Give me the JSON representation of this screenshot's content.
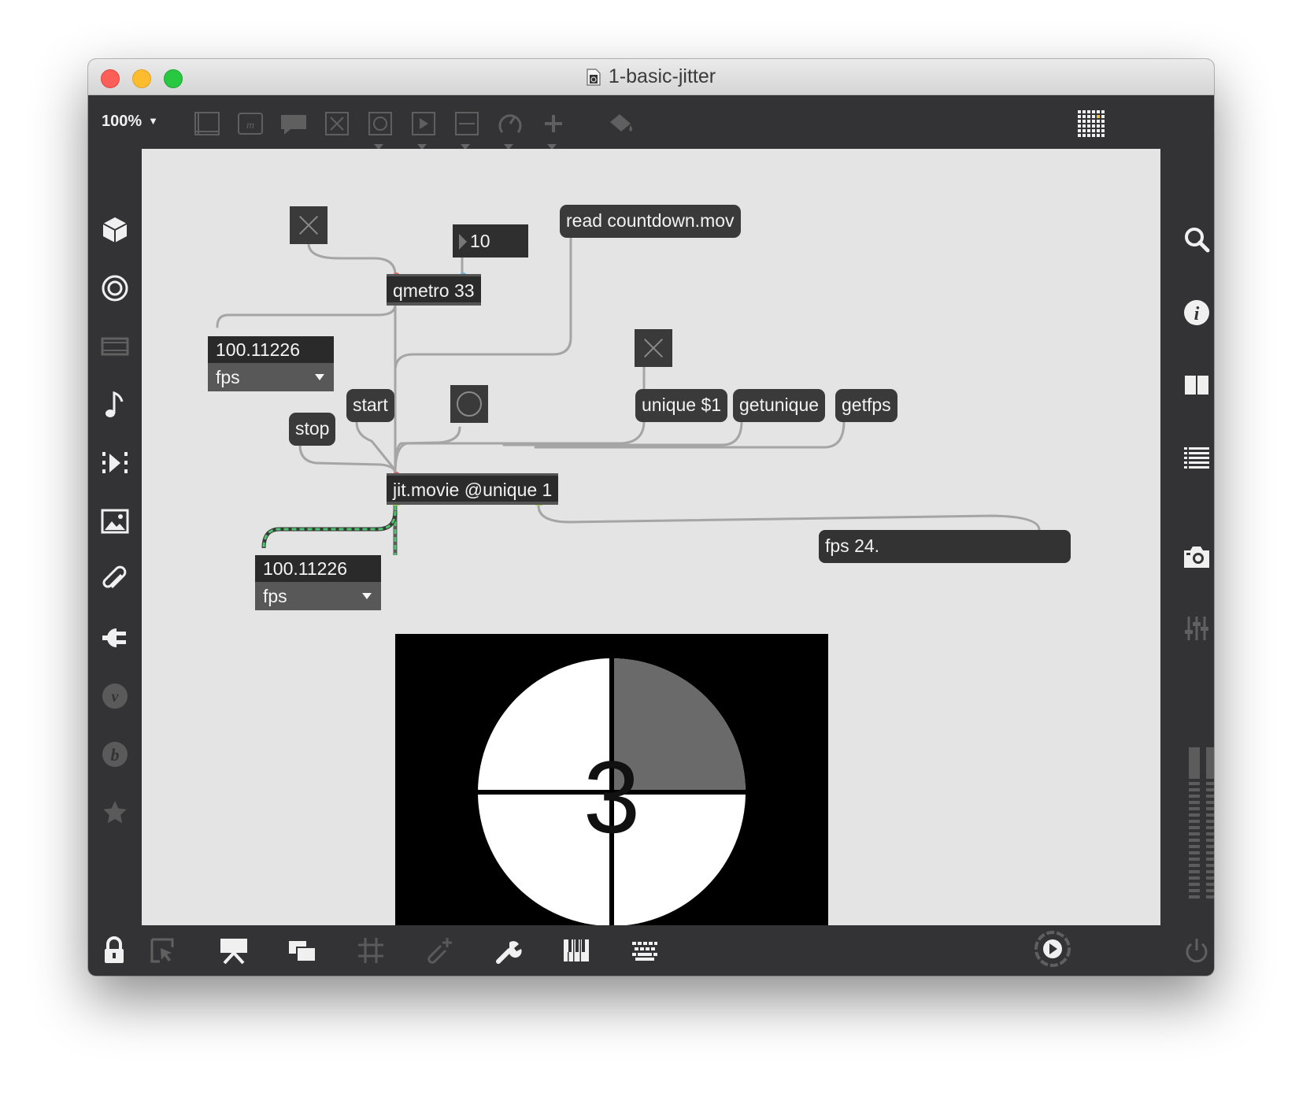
{
  "window": {
    "title": "1-basic-jitter"
  },
  "toolbar": {
    "zoom": "100%",
    "icons": [
      "new-object-icon",
      "message-box-icon",
      "comment-icon",
      "toggle-icon",
      "button-icon",
      "play-icon",
      "slider-icon",
      "dial-icon",
      "plus-icon",
      "paint-bucket-icon"
    ],
    "grid_icon": "grid-icon"
  },
  "left_sidebar": [
    "cube-icon",
    "target-icon",
    "film-icon",
    "music-note-icon",
    "step-icon",
    "image-icon",
    "paperclip-icon",
    "plug-icon",
    "v-icon",
    "b-icon",
    "star-icon"
  ],
  "right_sidebar": [
    "search-icon",
    "info-icon",
    "columns-icon",
    "list-icon",
    "camera-icon",
    "mixer-icon",
    "level-meter-icon"
  ],
  "bottom_bar": [
    "lock-icon",
    "cursor-icon",
    "presentation-icon",
    "windows-icon",
    "grid-icon",
    "pin-icon",
    "wrench-icon",
    "piano-icon",
    "keyboard-icon",
    "audio-play-icon",
    "power-icon"
  ],
  "patch": {
    "toggle1": "",
    "number_box": "10",
    "read_message": "read countdown.mov",
    "qmetro": "qmetro 33",
    "attrui_top": {
      "value": "100.11226",
      "attribute": "fps"
    },
    "start": "start",
    "stop": "stop",
    "toggle2": "",
    "unique_message": "unique $1",
    "getunique_message": "getunique",
    "getfps_message": "getfps",
    "jit_movie": "jit.movie @unique 1",
    "attrui_bottom": {
      "value": "100.11226",
      "attribute": "fps"
    },
    "fps_output": "fps 24.",
    "video_frame_digit": "3"
  },
  "colors": {
    "canvas": "#e4e4e4",
    "object": "#2f2f2f",
    "message": "#3a3a3a",
    "patchcord": "#a5a5a5",
    "matrix_cord": "#4cc46b"
  }
}
